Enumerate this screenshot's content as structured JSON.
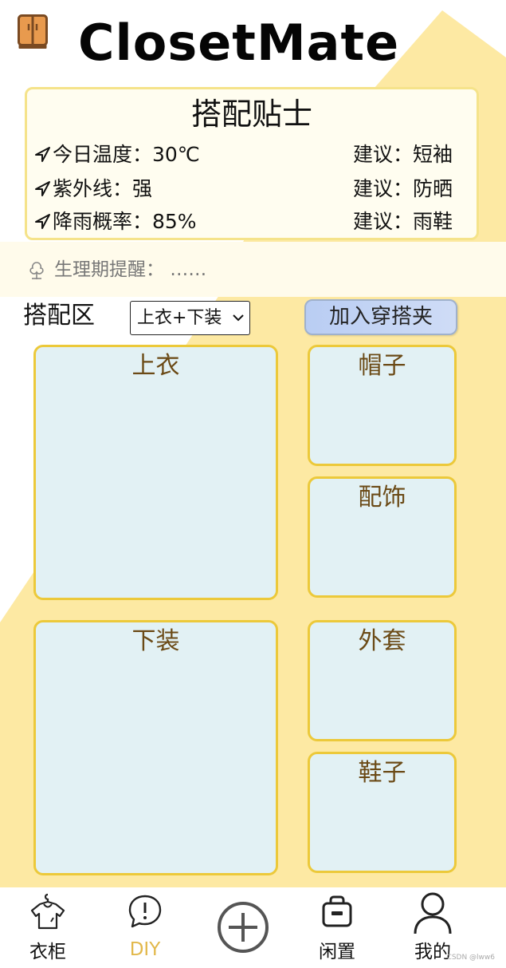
{
  "app": {
    "title": "ClosetMate"
  },
  "tips": {
    "title": "搭配贴士",
    "rows": [
      {
        "left": "今日温度：30℃",
        "right": "建议：短袖"
      },
      {
        "left": "紫外线：强",
        "right": "建议：防晒"
      },
      {
        "left": "降雨概率：85%",
        "right": "建议：雨鞋"
      }
    ]
  },
  "reminder": {
    "text": "生理期提醒：  ……"
  },
  "outfit": {
    "label": "搭配区",
    "select_value": "上衣+下装",
    "add_button": "加入穿搭夹",
    "slots": {
      "top": "上衣",
      "bottom": "下装",
      "hat": "帽子",
      "accessory": "配饰",
      "coat": "外套",
      "shoes": "鞋子"
    }
  },
  "nav": {
    "items": [
      {
        "label": "衣柜",
        "icon": "shirt-hanger-icon"
      },
      {
        "label": "DIY",
        "icon": "alert-bubble-icon",
        "active": true
      },
      {
        "label": "",
        "icon": "plus-circle-icon"
      },
      {
        "label": "闲置",
        "icon": "bag-icon"
      },
      {
        "label": "我的",
        "icon": "user-icon"
      }
    ]
  },
  "watermark": "CSDN @lww6",
  "colors": {
    "background_yellow": "#fde9a3",
    "slot_fill": "#e2f1f4",
    "slot_border": "#ecc93a",
    "slot_text": "#6b4a16",
    "active_nav": "#e2b84a"
  }
}
